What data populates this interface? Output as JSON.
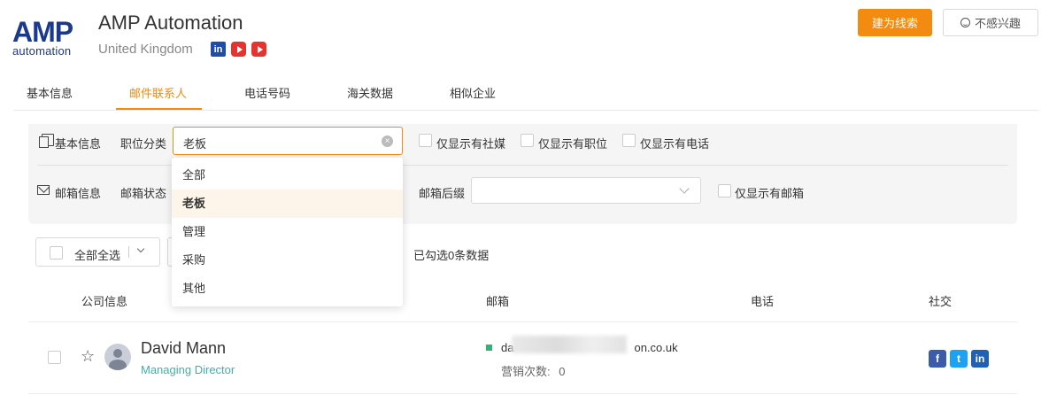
{
  "company": {
    "logo_text_big": "AMP",
    "logo_text_small": "automation",
    "name": "AMP Automation",
    "country": "United Kingdom",
    "socials": [
      "linkedin-icon",
      "youtube-icon",
      "youtube-icon"
    ]
  },
  "actions": {
    "lead_label": "建为线索",
    "no_interest_label": "不感兴趣"
  },
  "tabs": [
    {
      "label": "基本信息",
      "active": false
    },
    {
      "label": "邮件联系人",
      "active": true
    },
    {
      "label": "电话号码",
      "active": false
    },
    {
      "label": "海关数据",
      "active": false
    },
    {
      "label": "相似企业",
      "active": false
    }
  ],
  "filters": {
    "basic_info_label": "基本信息",
    "position_label": "职位分类",
    "position_value": "老板",
    "only_social": "仅显示有社媒",
    "only_position": "仅显示有职位",
    "only_phone": "仅显示有电话",
    "mailbox_info_label": "邮箱信息",
    "mailbox_status_label": "邮箱状态",
    "mailbox_suffix_label": "邮箱后缀",
    "mailbox_suffix_value": "",
    "only_email": "仅显示有邮箱"
  },
  "dropdown": {
    "options": [
      "全部",
      "老板",
      "管理",
      "采购",
      "其他"
    ],
    "selected": "老板"
  },
  "toolbar": {
    "select_all_label": "全部全选",
    "selected_count_text": "已勾选0条数据"
  },
  "table": {
    "headers": [
      "公司信息",
      "邮箱",
      "电话",
      "社交"
    ],
    "rows": [
      {
        "name": "David Mann",
        "title": "Managing Director",
        "email_start": "da",
        "email_end": "on.co.uk",
        "campaigns_label": "营销次数:",
        "campaigns_value": "0",
        "socials": [
          "facebook-icon",
          "twitter-icon",
          "linkedin-icon"
        ]
      }
    ]
  },
  "colors": {
    "accent": "#f28b0f",
    "brand": "#1b3a8c",
    "title_teal": "#3eb1a8",
    "status_green": "#2bb673"
  }
}
